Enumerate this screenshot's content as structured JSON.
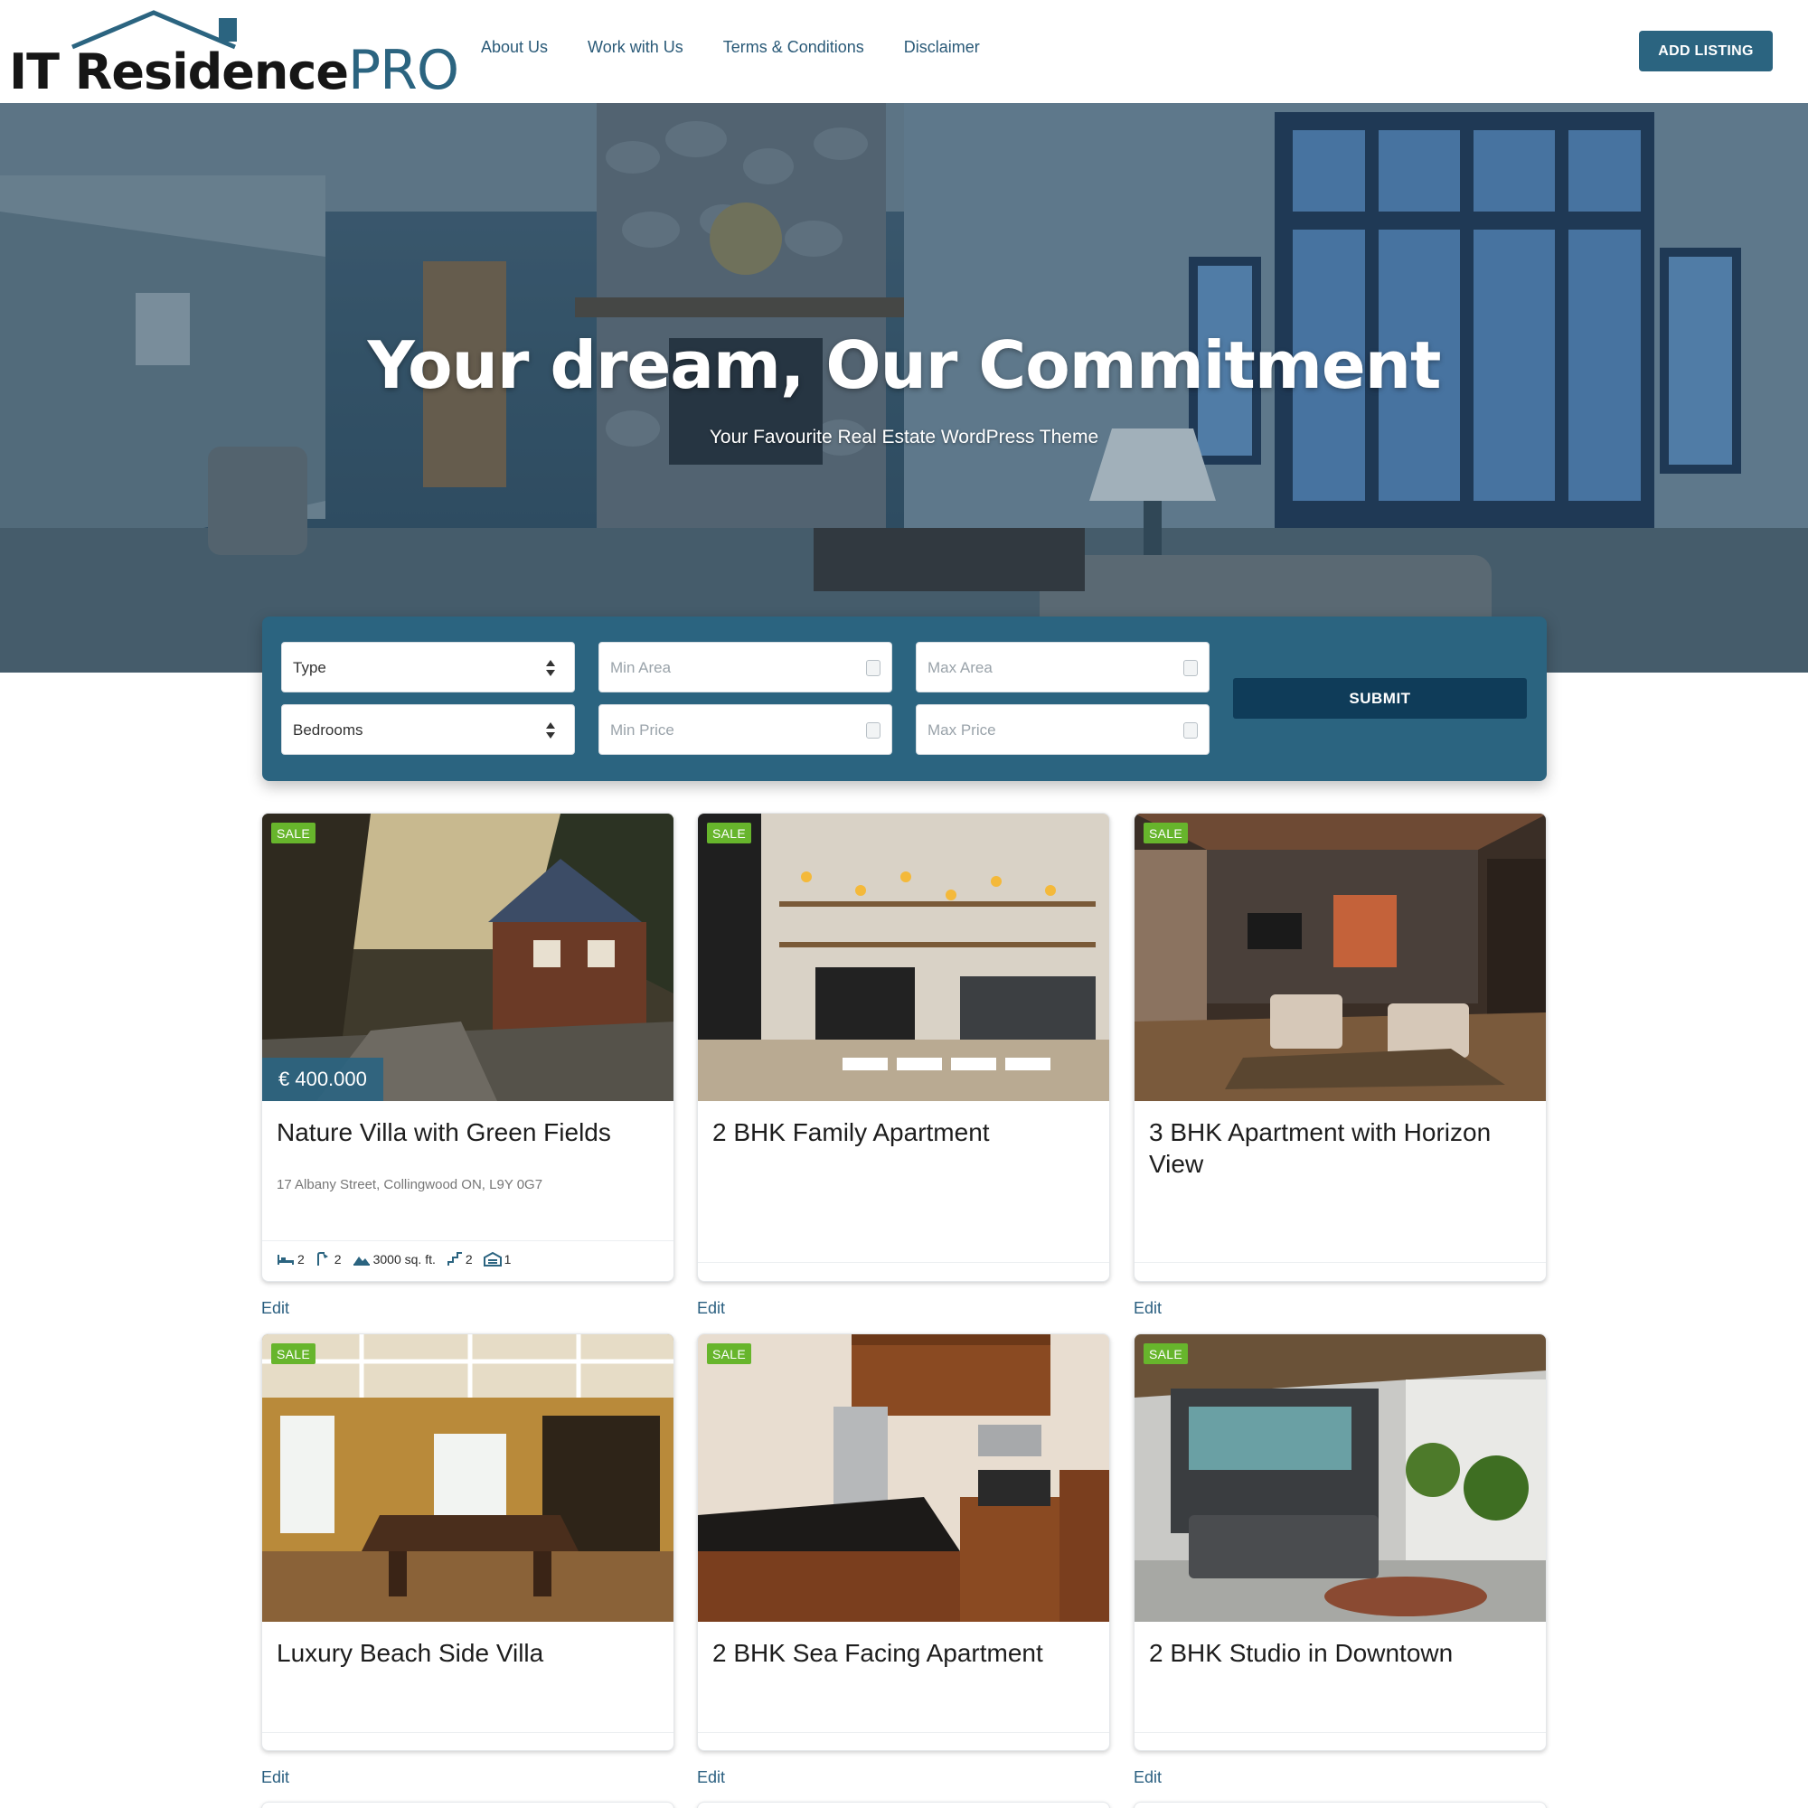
{
  "header": {
    "logo": {
      "part1": "IT ",
      "part2": "Residence",
      "part3": "PRO"
    },
    "nav": [
      "About Us",
      "Work with Us",
      "Terms & Conditions",
      "Disclaimer"
    ],
    "add_listing": "ADD LISTING"
  },
  "hero": {
    "title": "Your dream, Our Commitment",
    "subtitle": "Your Favourite Real Estate WordPress Theme"
  },
  "search": {
    "type": "Type",
    "bedrooms": "Bedrooms",
    "min_area": "Min Area",
    "max_area": "Max Area",
    "min_price": "Min Price",
    "max_price": "Max Price",
    "submit": "SUBMIT"
  },
  "colors": {
    "brand": "#2b6480",
    "brand_dark": "#0f3c59",
    "sale_badge": "#67b52c",
    "link": "#2a5f80"
  },
  "listings": [
    {
      "badge": "SALE",
      "price": "€ 400.000",
      "title": "Nature Villa with Green Fields",
      "address": "17 Albany Street, Collingwood ON, L9Y 0G7",
      "bedrooms": "2",
      "bathrooms": "2",
      "area": "3000 sq. ft.",
      "floors": "2",
      "garage": "1",
      "edit": "Edit"
    },
    {
      "badge": "SALE",
      "title": "2 BHK Family Apartment",
      "edit": "Edit"
    },
    {
      "badge": "SALE",
      "title": "3 BHK Apartment with Horizon View",
      "edit": "Edit"
    },
    {
      "badge": "SALE",
      "title": "Luxury Beach Side Villa",
      "edit": "Edit"
    },
    {
      "badge": "SALE",
      "title": "2 BHK Sea Facing Apartment",
      "edit": "Edit"
    },
    {
      "badge": "SALE",
      "title": "2 BHK Studio in Downtown",
      "edit": "Edit"
    }
  ]
}
